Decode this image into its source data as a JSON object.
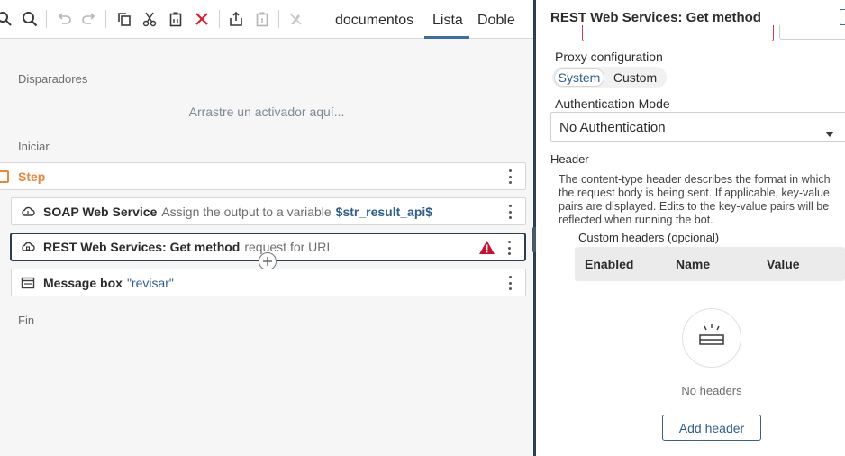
{
  "toolbar": {
    "tabs": [
      "documentos",
      "Lista",
      "Doble"
    ],
    "active_tab": "Lista"
  },
  "flow": {
    "triggers_label": "Disparadores",
    "drop_hint": "Arrastre un activador aquí...",
    "start_label": "Iniciar",
    "end_label": "Fin",
    "step": {
      "title": "Step"
    },
    "actions": [
      {
        "title": "SOAP Web Service",
        "desc": "Assign the output to a variable",
        "var": "$str_result_api$"
      },
      {
        "title": "REST Web Services: Get method",
        "desc": "request for URI"
      },
      {
        "title": "Message box",
        "quoted": "\"revisar\""
      }
    ]
  },
  "panel": {
    "title": "REST Web Services: Get method",
    "proxy": {
      "label": "Proxy configuration",
      "options": [
        "System",
        "Custom"
      ],
      "selected": "System"
    },
    "auth": {
      "label": "Authentication Mode",
      "value": "No Authentication"
    },
    "header": {
      "label": "Header",
      "description": "The content-type header describes the format in which the request body is being sent. If applicable, key-value pairs are displayed. Edits to the key-value pairs will be reflected when running the bot.",
      "custom_label": "Custom headers (opcional)",
      "columns": [
        "Enabled",
        "Name",
        "Value"
      ],
      "empty_text": "No headers",
      "add_button": "Add header"
    }
  },
  "colors": {
    "accent": "#2f5f8f",
    "step_orange": "#e8873a",
    "warning_red": "#c8102e",
    "divider": "#2c3e50"
  }
}
